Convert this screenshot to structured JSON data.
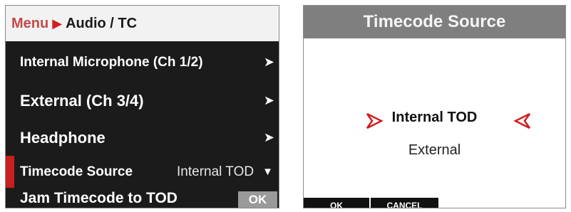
{
  "menu": {
    "breadcrumb": {
      "root": "Menu",
      "separator": ">",
      "current": "Audio / TC"
    },
    "items": [
      {
        "label": "Internal Microphone (Ch 1/2)",
        "indicator": "chevron-right"
      },
      {
        "label": "External (Ch 3/4)",
        "indicator": "chevron-right"
      },
      {
        "label": "Headphone",
        "indicator": "chevron-right"
      },
      {
        "label": "Timecode Source",
        "value": "Internal TOD",
        "indicator": "chevron-down",
        "selected": true
      },
      {
        "label": "Jam Timecode to TOD",
        "action": "OK"
      }
    ]
  },
  "dialog": {
    "title": "Timecode Source",
    "selected_option": "Internal TOD",
    "other_option": "External",
    "soft_keys": {
      "ok": "OK",
      "cancel": "CANCEL"
    }
  },
  "colors": {
    "accent": "#c81f1f",
    "menu_background": "#1b1b1b",
    "breadcrumb_background": "#f2f2f2",
    "dialog_title_background": "#7f7f7f",
    "ok_badge_background": "#9a9a9a"
  }
}
